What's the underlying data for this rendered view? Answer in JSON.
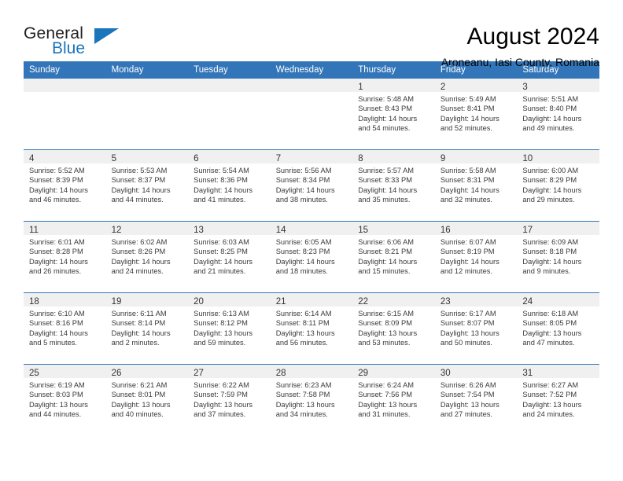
{
  "brand": {
    "name_part1": "General",
    "name_part2": "Blue",
    "accent_color": "#1b75bb"
  },
  "header": {
    "title": "August 2024",
    "location": "Aroneanu, Iasi County, Romania"
  },
  "theme": {
    "header_blue": "#3275b8",
    "day_band_gray": "#f0f0f0"
  },
  "weekday_headers": [
    "Sunday",
    "Monday",
    "Tuesday",
    "Wednesday",
    "Thursday",
    "Friday",
    "Saturday"
  ],
  "labels": {
    "sunrise_prefix": "Sunrise:",
    "sunset_prefix": "Sunset:",
    "daylight_prefix": "Daylight:"
  },
  "weeks": [
    [
      {
        "empty": true
      },
      {
        "empty": true
      },
      {
        "empty": true
      },
      {
        "empty": true
      },
      {
        "day": "1",
        "sunrise": "Sunrise: 5:48 AM",
        "sunset": "Sunset: 8:43 PM",
        "daylight_line1": "Daylight: 14 hours",
        "daylight_line2": "and 54 minutes."
      },
      {
        "day": "2",
        "sunrise": "Sunrise: 5:49 AM",
        "sunset": "Sunset: 8:41 PM",
        "daylight_line1": "Daylight: 14 hours",
        "daylight_line2": "and 52 minutes."
      },
      {
        "day": "3",
        "sunrise": "Sunrise: 5:51 AM",
        "sunset": "Sunset: 8:40 PM",
        "daylight_line1": "Daylight: 14 hours",
        "daylight_line2": "and 49 minutes."
      }
    ],
    [
      {
        "day": "4",
        "sunrise": "Sunrise: 5:52 AM",
        "sunset": "Sunset: 8:39 PM",
        "daylight_line1": "Daylight: 14 hours",
        "daylight_line2": "and 46 minutes."
      },
      {
        "day": "5",
        "sunrise": "Sunrise: 5:53 AM",
        "sunset": "Sunset: 8:37 PM",
        "daylight_line1": "Daylight: 14 hours",
        "daylight_line2": "and 44 minutes."
      },
      {
        "day": "6",
        "sunrise": "Sunrise: 5:54 AM",
        "sunset": "Sunset: 8:36 PM",
        "daylight_line1": "Daylight: 14 hours",
        "daylight_line2": "and 41 minutes."
      },
      {
        "day": "7",
        "sunrise": "Sunrise: 5:56 AM",
        "sunset": "Sunset: 8:34 PM",
        "daylight_line1": "Daylight: 14 hours",
        "daylight_line2": "and 38 minutes."
      },
      {
        "day": "8",
        "sunrise": "Sunrise: 5:57 AM",
        "sunset": "Sunset: 8:33 PM",
        "daylight_line1": "Daylight: 14 hours",
        "daylight_line2": "and 35 minutes."
      },
      {
        "day": "9",
        "sunrise": "Sunrise: 5:58 AM",
        "sunset": "Sunset: 8:31 PM",
        "daylight_line1": "Daylight: 14 hours",
        "daylight_line2": "and 32 minutes."
      },
      {
        "day": "10",
        "sunrise": "Sunrise: 6:00 AM",
        "sunset": "Sunset: 8:29 PM",
        "daylight_line1": "Daylight: 14 hours",
        "daylight_line2": "and 29 minutes."
      }
    ],
    [
      {
        "day": "11",
        "sunrise": "Sunrise: 6:01 AM",
        "sunset": "Sunset: 8:28 PM",
        "daylight_line1": "Daylight: 14 hours",
        "daylight_line2": "and 26 minutes."
      },
      {
        "day": "12",
        "sunrise": "Sunrise: 6:02 AM",
        "sunset": "Sunset: 8:26 PM",
        "daylight_line1": "Daylight: 14 hours",
        "daylight_line2": "and 24 minutes."
      },
      {
        "day": "13",
        "sunrise": "Sunrise: 6:03 AM",
        "sunset": "Sunset: 8:25 PM",
        "daylight_line1": "Daylight: 14 hours",
        "daylight_line2": "and 21 minutes."
      },
      {
        "day": "14",
        "sunrise": "Sunrise: 6:05 AM",
        "sunset": "Sunset: 8:23 PM",
        "daylight_line1": "Daylight: 14 hours",
        "daylight_line2": "and 18 minutes."
      },
      {
        "day": "15",
        "sunrise": "Sunrise: 6:06 AM",
        "sunset": "Sunset: 8:21 PM",
        "daylight_line1": "Daylight: 14 hours",
        "daylight_line2": "and 15 minutes."
      },
      {
        "day": "16",
        "sunrise": "Sunrise: 6:07 AM",
        "sunset": "Sunset: 8:19 PM",
        "daylight_line1": "Daylight: 14 hours",
        "daylight_line2": "and 12 minutes."
      },
      {
        "day": "17",
        "sunrise": "Sunrise: 6:09 AM",
        "sunset": "Sunset: 8:18 PM",
        "daylight_line1": "Daylight: 14 hours",
        "daylight_line2": "and 9 minutes."
      }
    ],
    [
      {
        "day": "18",
        "sunrise": "Sunrise: 6:10 AM",
        "sunset": "Sunset: 8:16 PM",
        "daylight_line1": "Daylight: 14 hours",
        "daylight_line2": "and 5 minutes."
      },
      {
        "day": "19",
        "sunrise": "Sunrise: 6:11 AM",
        "sunset": "Sunset: 8:14 PM",
        "daylight_line1": "Daylight: 14 hours",
        "daylight_line2": "and 2 minutes."
      },
      {
        "day": "20",
        "sunrise": "Sunrise: 6:13 AM",
        "sunset": "Sunset: 8:12 PM",
        "daylight_line1": "Daylight: 13 hours",
        "daylight_line2": "and 59 minutes."
      },
      {
        "day": "21",
        "sunrise": "Sunrise: 6:14 AM",
        "sunset": "Sunset: 8:11 PM",
        "daylight_line1": "Daylight: 13 hours",
        "daylight_line2": "and 56 minutes."
      },
      {
        "day": "22",
        "sunrise": "Sunrise: 6:15 AM",
        "sunset": "Sunset: 8:09 PM",
        "daylight_line1": "Daylight: 13 hours",
        "daylight_line2": "and 53 minutes."
      },
      {
        "day": "23",
        "sunrise": "Sunrise: 6:17 AM",
        "sunset": "Sunset: 8:07 PM",
        "daylight_line1": "Daylight: 13 hours",
        "daylight_line2": "and 50 minutes."
      },
      {
        "day": "24",
        "sunrise": "Sunrise: 6:18 AM",
        "sunset": "Sunset: 8:05 PM",
        "daylight_line1": "Daylight: 13 hours",
        "daylight_line2": "and 47 minutes."
      }
    ],
    [
      {
        "day": "25",
        "sunrise": "Sunrise: 6:19 AM",
        "sunset": "Sunset: 8:03 PM",
        "daylight_line1": "Daylight: 13 hours",
        "daylight_line2": "and 44 minutes."
      },
      {
        "day": "26",
        "sunrise": "Sunrise: 6:21 AM",
        "sunset": "Sunset: 8:01 PM",
        "daylight_line1": "Daylight: 13 hours",
        "daylight_line2": "and 40 minutes."
      },
      {
        "day": "27",
        "sunrise": "Sunrise: 6:22 AM",
        "sunset": "Sunset: 7:59 PM",
        "daylight_line1": "Daylight: 13 hours",
        "daylight_line2": "and 37 minutes."
      },
      {
        "day": "28",
        "sunrise": "Sunrise: 6:23 AM",
        "sunset": "Sunset: 7:58 PM",
        "daylight_line1": "Daylight: 13 hours",
        "daylight_line2": "and 34 minutes."
      },
      {
        "day": "29",
        "sunrise": "Sunrise: 6:24 AM",
        "sunset": "Sunset: 7:56 PM",
        "daylight_line1": "Daylight: 13 hours",
        "daylight_line2": "and 31 minutes."
      },
      {
        "day": "30",
        "sunrise": "Sunrise: 6:26 AM",
        "sunset": "Sunset: 7:54 PM",
        "daylight_line1": "Daylight: 13 hours",
        "daylight_line2": "and 27 minutes."
      },
      {
        "day": "31",
        "sunrise": "Sunrise: 6:27 AM",
        "sunset": "Sunset: 7:52 PM",
        "daylight_line1": "Daylight: 13 hours",
        "daylight_line2": "and 24 minutes."
      }
    ]
  ]
}
